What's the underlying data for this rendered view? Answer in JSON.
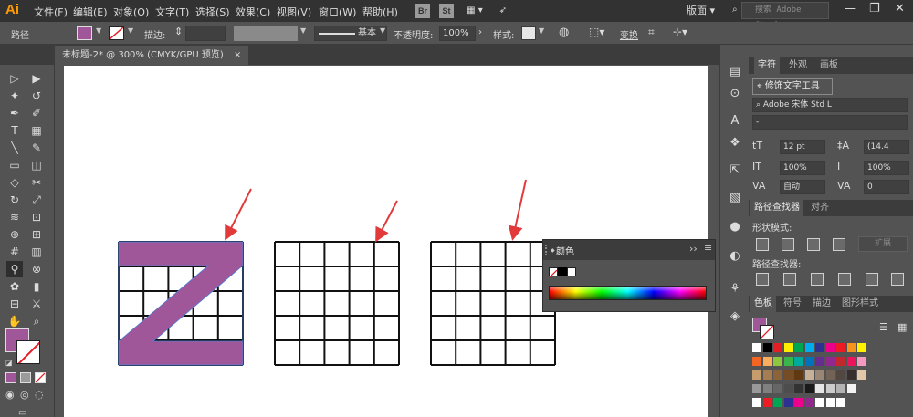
{
  "app": {
    "logo": "Ai"
  },
  "menu": [
    "文件(F)",
    "编辑(E)",
    "对象(O)",
    "文字(T)",
    "选择(S)",
    "效果(C)",
    "视图(V)",
    "窗口(W)",
    "帮助(H)"
  ],
  "menubar": {
    "bridge": "Br",
    "stock": "St",
    "workspace": "版面",
    "search_placeholder": "搜索 Adobe Stock",
    "minimize": "—",
    "restore": "❐",
    "close": "✕"
  },
  "control_bar": {
    "object_type": "路径",
    "stroke_label": "描边:",
    "stroke_profile": "基本",
    "opacity_label": "不透明度:",
    "opacity_value": "100%",
    "style_label": "样式:",
    "transform_label": "变换",
    "fill_color": "#a0579a"
  },
  "document_tab": {
    "title": "未标题-2* @ 300% (CMYK/GPU 预览)",
    "close": "×"
  },
  "toolbar": {
    "fill_color": "#a0579a",
    "tools": [
      "selection-tool",
      "direct-selection-tool",
      "magic-wand-tool",
      "lasso-tool",
      "pen-tool",
      "curvature-tool",
      "type-tool",
      "grid-tool",
      "line-segment-tool",
      "paintbrush-tool",
      "rectangle-tool",
      "eraser-tool",
      "shaper-tool",
      "scissors-tool",
      "rotate-tool",
      "scale-tool",
      "width-tool",
      "free-transform-tool",
      "shape-builder-tool",
      "perspective-grid-tool",
      "mesh-tool",
      "gradient-tool",
      "eyedropper-tool",
      "blend-tool",
      "symbol-sprayer-tool",
      "column-graph-tool",
      "artboard-tool",
      "slice-tool",
      "hand-tool",
      "zoom-tool"
    ]
  },
  "color_panel": {
    "title": "颜色",
    "collapse": "››",
    "menu": "≡"
  },
  "right_panel": {
    "char_tabs": [
      "字符",
      "外观",
      "画板"
    ],
    "touch_type_button": "修饰文字工具",
    "font_family": "Adobe 宋体 Std L",
    "font_style": "-",
    "font_size": "12 pt",
    "leading": "(14.4",
    "vscale": "100%",
    "hscale": "100%",
    "kerning": "自动",
    "tracking": "0",
    "pathfinder_tabs": [
      "路径查找器",
      "对齐"
    ],
    "shape_modes_label": "形状模式:",
    "expand_button": "扩展",
    "pathfinders_label": "路径查找器:",
    "swatch_tabs": [
      "色板",
      "符号",
      "描边",
      "图形样式"
    ],
    "current_swatch": "#a0579a"
  },
  "swatches": {
    "row1": [
      "#ffffff",
      "#000000",
      "#e31e24",
      "#ffed00",
      "#00a651",
      "#00aeef",
      "#2e3192",
      "#ec008c",
      "#ed1c24",
      "#f7941d",
      "#fff200"
    ],
    "row2": [
      "#f26522",
      "#fbaf5d",
      "#8dc63f",
      "#39b54a",
      "#00a99d",
      "#0072bc",
      "#662d91",
      "#92278f",
      "#c1272d",
      "#ed145b",
      "#f49ac1"
    ],
    "row3": [
      "#c69c6d",
      "#a67c52",
      "#8c6239",
      "#754c24",
      "#603913",
      "#c7b299",
      "#998675",
      "#736357",
      "#534741",
      "#362f2d",
      "#e2c7a8"
    ],
    "row4": [
      "#999999",
      "#808080",
      "#666666",
      "#4d4d4d",
      "#333333",
      "#1a1a1a",
      "#e6e6e6",
      "#cccccc",
      "#b3b3b3",
      "#f2f2f2"
    ],
    "row5": [
      "#ffffff",
      "#ed1c24",
      "#00a651",
      "#2e3192",
      "#ec008c",
      "#92278f",
      "#ffffff",
      "#ffffff",
      "#ffffff"
    ]
  }
}
